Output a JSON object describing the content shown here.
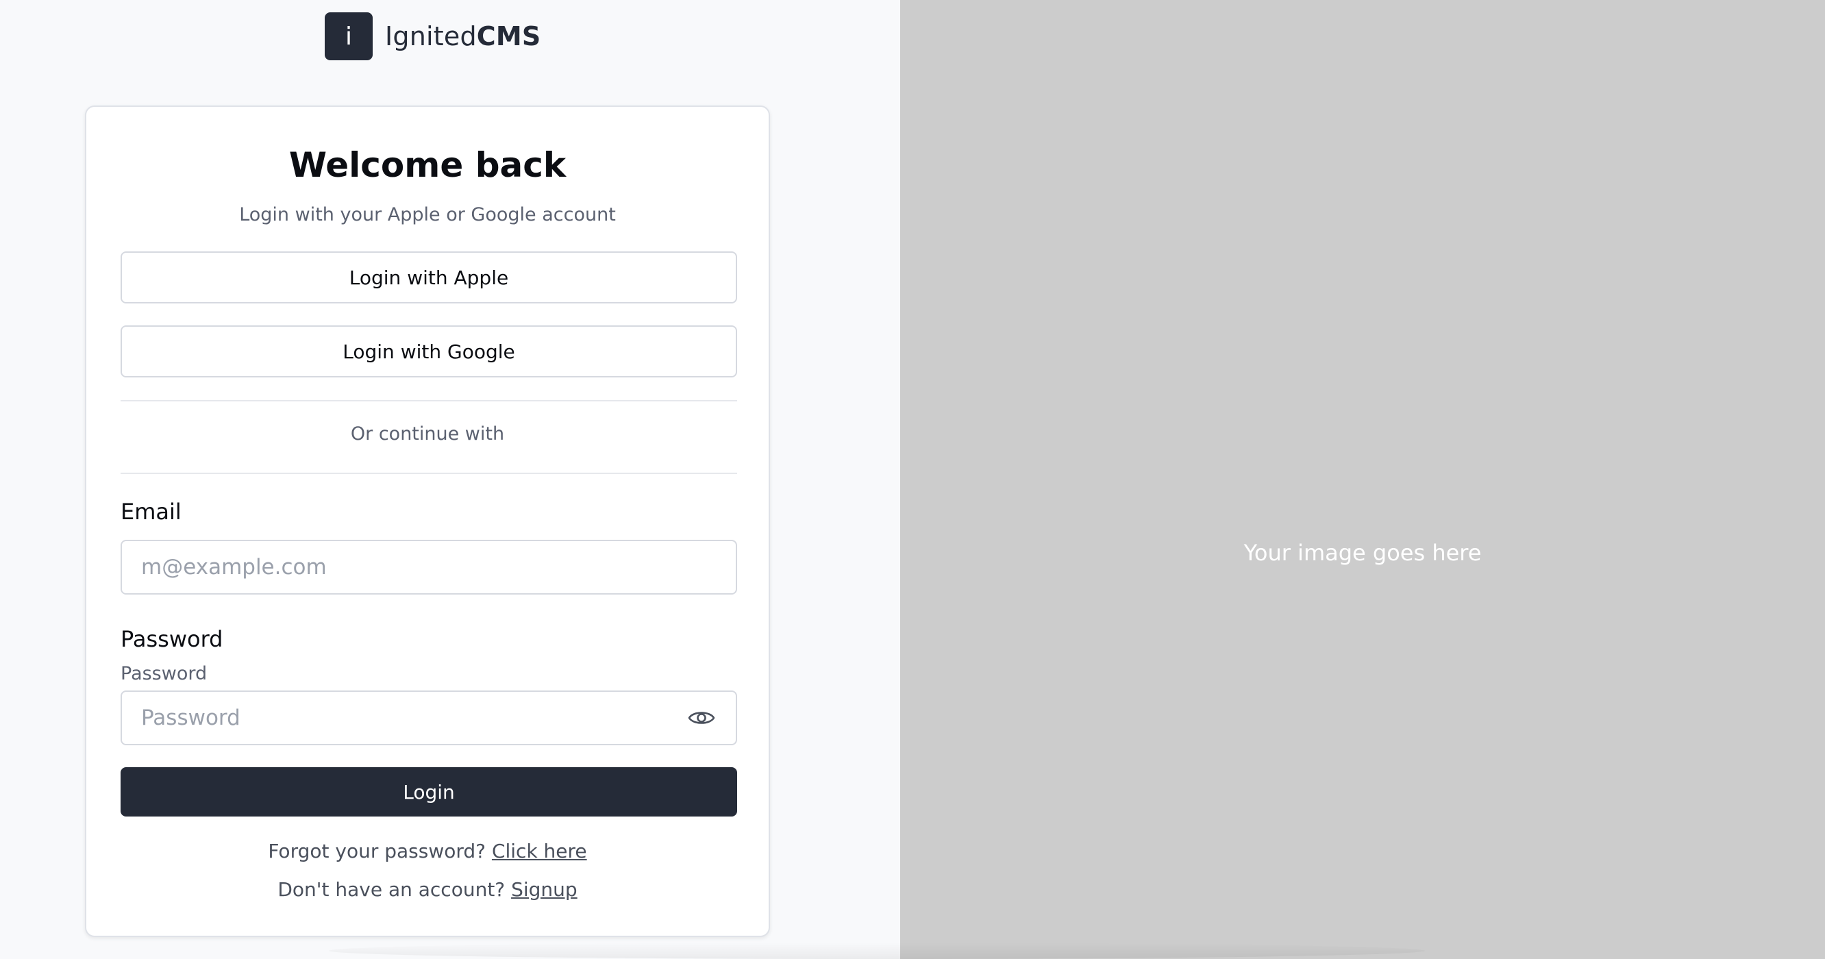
{
  "brand": {
    "logo_letter": "i",
    "name_regular": "Ignited",
    "name_bold": "CMS"
  },
  "card": {
    "title": "Welcome back",
    "subtitle": "Login with your Apple or Google account",
    "apple_button": "Login with Apple",
    "google_button": "Login with Google",
    "divider_text": "Or continue with",
    "email_label": "Email",
    "email_placeholder": "m@example.com",
    "password_label": "Password",
    "password_sublabel": "Password",
    "password_placeholder": "Password",
    "login_button": "Login",
    "forgot_text": "Forgot your password?",
    "forgot_link": "Click here",
    "signup_text": "Don't have an account?",
    "signup_link": "Signup"
  },
  "image_panel": {
    "placeholder_text": "Your image goes here"
  },
  "icons": {
    "show_password": "eye-icon"
  },
  "colors": {
    "primary": "#252b38",
    "page_bg": "#f8f9fb",
    "image_bg": "#cccccc"
  }
}
